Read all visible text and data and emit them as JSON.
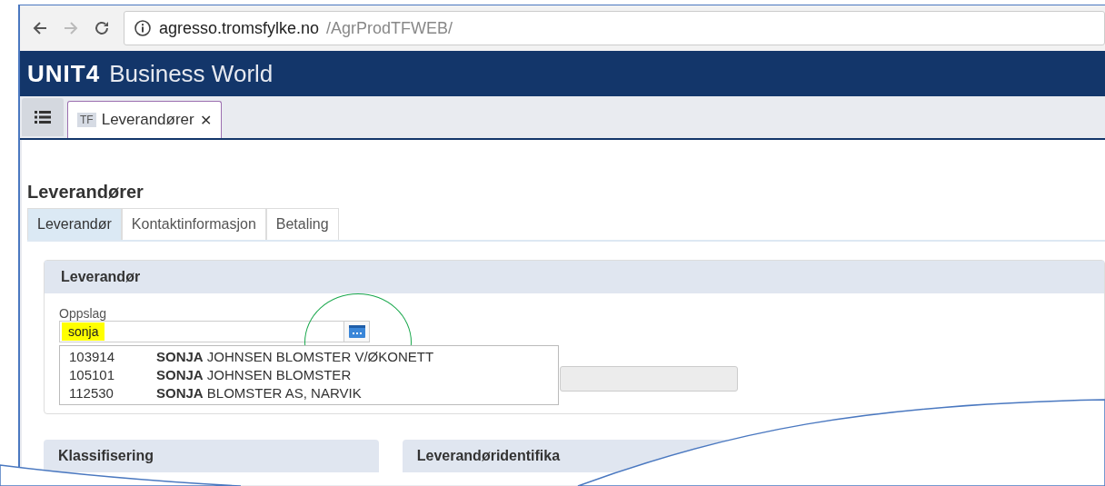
{
  "browser": {
    "url_host": "agresso.tromsfylke.no",
    "url_path": "/AgrProdTFWEB/"
  },
  "app": {
    "logo": "UNIT4",
    "title": "Business World"
  },
  "doc_tabs": [
    {
      "badge": "TF",
      "label": "Leverandører",
      "close": "✕",
      "selected": true
    }
  ],
  "page_title": "Leverandører",
  "tabs": [
    {
      "label": "Leverandør",
      "selected": true
    },
    {
      "label": "Kontaktinformasjon",
      "selected": false
    },
    {
      "label": "Betaling",
      "selected": false
    }
  ],
  "section": {
    "title": "Leverandør",
    "field": {
      "label": "Oppslag",
      "value": "sonja",
      "highlighted": true,
      "circled": true
    },
    "suggestions": [
      {
        "id": "103914",
        "match": "SONJA",
        "rest": " JOHNSEN BLOMSTER V/ØKONETT"
      },
      {
        "id": "105101",
        "match": "SONJA",
        "rest": " JOHNSEN BLOMSTER"
      },
      {
        "id": "112530",
        "match": "SONJA",
        "rest": " BLOMSTER AS, NARVIK"
      }
    ]
  },
  "panels": [
    {
      "title": "Klassifisering"
    },
    {
      "title": "Leverandøridentifika"
    }
  ]
}
